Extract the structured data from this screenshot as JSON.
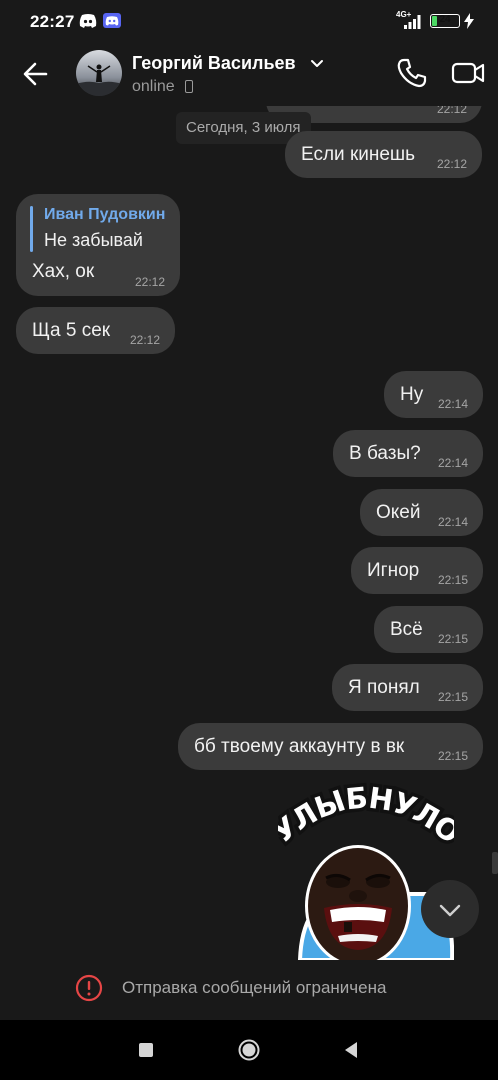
{
  "status_bar": {
    "time": "22:27",
    "network": "4G+",
    "battery": "24",
    "battery_fraction": 0.24,
    "icons": [
      "discord-icon",
      "discord-icon",
      "signal-icon",
      "battery-icon",
      "charging-icon"
    ]
  },
  "header": {
    "name": "Георгий Васильев",
    "status": "online",
    "icons": [
      "back-arrow-icon",
      "chevron-down-icon",
      "mobile-device-icon",
      "phone-icon",
      "video-camera-icon"
    ]
  },
  "chat": {
    "date_separator": "Сегодня, 3 июля",
    "messages": [
      {
        "side": "out",
        "text": "",
        "time": "22:12"
      },
      {
        "side": "out",
        "text": "Если кинешь",
        "time": "22:12"
      },
      {
        "side": "in",
        "reply_author": "Иван Пудовкин",
        "reply_text": "Не забывай",
        "text": "Хах, ок",
        "time": "22:12"
      },
      {
        "side": "in",
        "text": "Ща 5 сек",
        "time": "22:12"
      },
      {
        "side": "out",
        "text": "Ну",
        "time": "22:14"
      },
      {
        "side": "out",
        "text": "В базы?",
        "time": "22:14"
      },
      {
        "side": "out",
        "text": "Окей",
        "time": "22:14"
      },
      {
        "side": "out",
        "text": "Игнор",
        "time": "22:15"
      },
      {
        "side": "out",
        "text": "Всё",
        "time": "22:15"
      },
      {
        "side": "out",
        "text": "Я понял",
        "time": "22:15"
      },
      {
        "side": "out",
        "text": "бб твоему аккаунту в вк",
        "time": "22:15"
      }
    ],
    "sticker_caption": "УЛЫБНУЛО"
  },
  "footer": {
    "restriction_text": "Отправка сообщений ограничена",
    "restriction_color": "#e64646"
  },
  "colors": {
    "background": "#191919",
    "bubble": "#3b3b3b",
    "accent": "#71aaeb"
  }
}
